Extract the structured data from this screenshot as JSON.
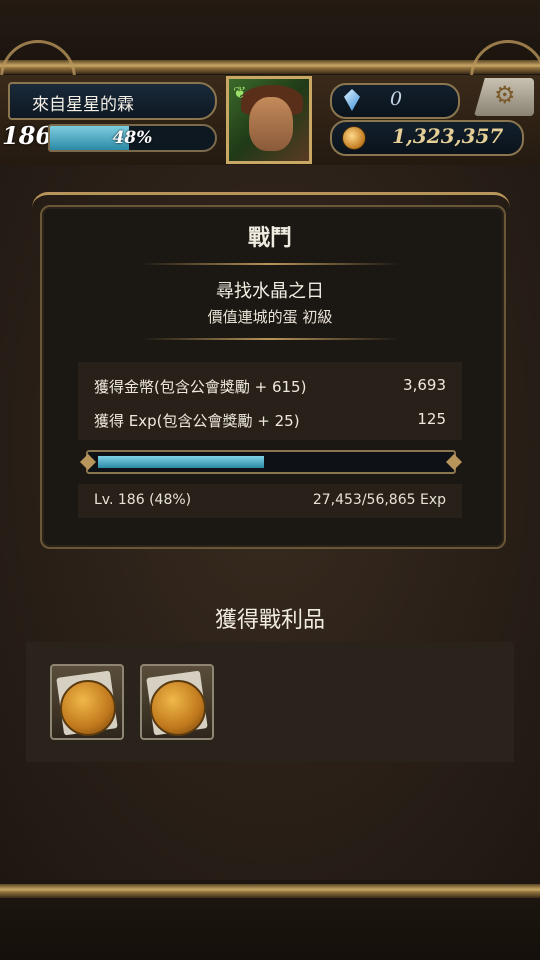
{
  "player": {
    "name": "來自星星的霖",
    "level": "186",
    "xp_percent_text": "48%",
    "xp_fraction": 0.48,
    "gems": "0",
    "gold": "1,323,357"
  },
  "battle": {
    "title": "戰鬥",
    "quest_name": "尋找水晶之日",
    "quest_sub": "價值連城的蛋 初級",
    "rewards": [
      {
        "label": "獲得金幣(包含公會獎勵 + 615)",
        "value": "3,693"
      },
      {
        "label": "獲得 Exp(包含公會獎勵 + 25)",
        "value": "125"
      }
    ],
    "exp_bar_fraction": 0.48,
    "level_text": "Lv. 186 (48%)",
    "exp_text": "27,453/56,865 Exp"
  },
  "loot": {
    "title": "獲得戰利品",
    "items": [
      {
        "icon": "gold-coin-card-icon"
      },
      {
        "icon": "gold-coin-card-icon"
      }
    ]
  },
  "colors": {
    "accent_gold": "#c9a764",
    "exp_blue": "#2b8aa6",
    "background": "#2a2018"
  },
  "icons": {
    "settings": "gears-icon",
    "gem": "crystal-icon",
    "coin": "gold-coin-icon"
  }
}
